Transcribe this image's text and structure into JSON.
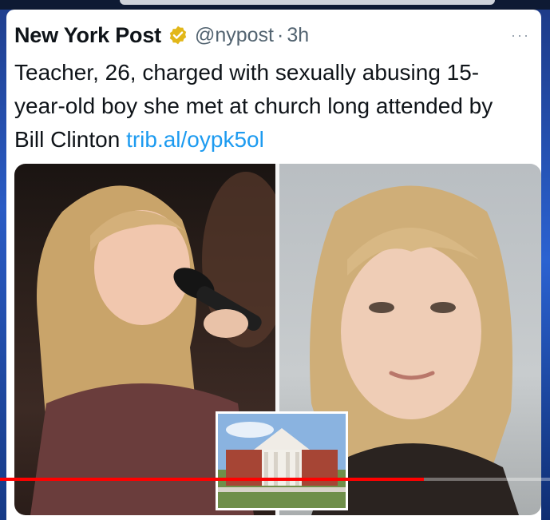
{
  "tweet": {
    "author_name": "New York Post",
    "handle": "@nypost",
    "separator": "·",
    "time": "3h",
    "more": "···",
    "text_main": "Teacher, 26, charged with sexually abusing 15-year-old boy she met at church long attended by Bill Clinton",
    "link_text": "trib.al/oypk5ol"
  },
  "icons": {
    "verified": "verified-badge-icon",
    "more": "more-options-icon"
  },
  "colors": {
    "verified_gold": "#e2b719",
    "link_blue": "#1d9bf0",
    "progress_red": "#ff0000"
  },
  "video": {
    "progress_fraction": 0.77
  }
}
